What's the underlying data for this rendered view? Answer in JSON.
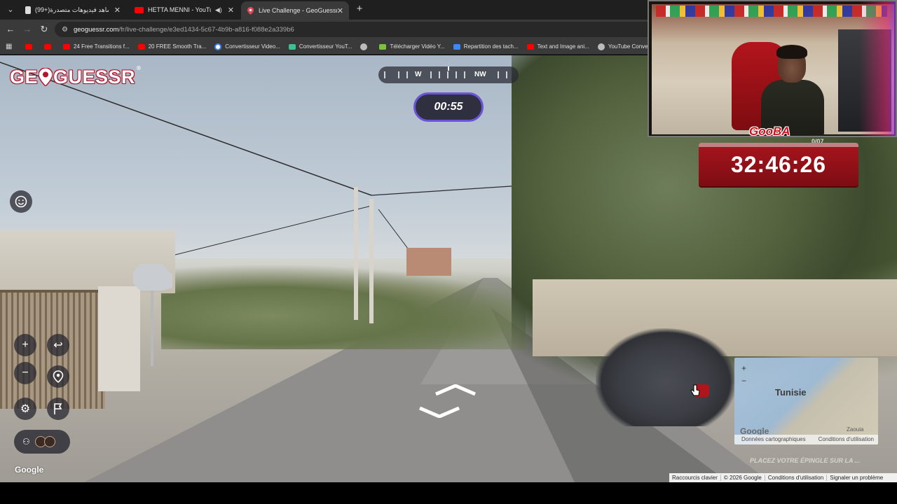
{
  "browser": {
    "tabs": [
      {
        "title": "(99+)شاهد فيديوهات متصدرة",
        "favicon_color": "#ffffff",
        "active": false
      },
      {
        "title": "HETTA MENNI - YouTube",
        "favicon_color": "#ff0000",
        "active": false,
        "audio": true
      },
      {
        "title": "Live Challenge - GeoGuessr",
        "favicon_color": "#e24a5a",
        "active": true
      }
    ],
    "tab_close_glyph": "✕",
    "new_tab_glyph": "+",
    "address": {
      "domain": "geoguessr.com",
      "path": "/fr/live-challenge/e3ed1434-5c67-4b9b-a816-f088e2a339b6"
    },
    "bookmarks": [
      {
        "label": "",
        "icon": "youtube-icon",
        "color": "#ff0000"
      },
      {
        "label": "",
        "icon": "youtube-icon",
        "color": "#ff0000"
      },
      {
        "label": "24 Free Transitions f...",
        "icon": "youtube-icon",
        "color": "#ff0000"
      },
      {
        "label": "20 FREE Smooth Tra...",
        "icon": "youtube-icon",
        "color": "#ff0000"
      },
      {
        "label": "Convertisseur Video...",
        "icon": "google-icon",
        "color": "#ffffff"
      },
      {
        "label": "Convertisseur YouT...",
        "icon": "convert-icon",
        "color": "#3fbf8f"
      },
      {
        "label": "",
        "icon": "globe-icon",
        "color": "#bbbbbb"
      },
      {
        "label": "Télécharger Vidéo Y...",
        "icon": "download-icon",
        "color": "#7cc242"
      },
      {
        "label": "Repartition des tach...",
        "icon": "docs-icon",
        "color": "#4285f4"
      },
      {
        "label": "Text and Image ani...",
        "icon": "youtube-icon",
        "color": "#ff0000"
      },
      {
        "label": "YouTube Converter...",
        "icon": "globe-icon",
        "color": "#bbbbbb"
      }
    ]
  },
  "game": {
    "logo_text": [
      "GE",
      "GUESSR"
    ],
    "logo_reg": "®",
    "compass": {
      "west": "W",
      "northwest": "NW"
    },
    "round_timer": "00:55",
    "map_label": "Tunisie",
    "map_place_small": "Zaouia",
    "map_footer_left": "Données cartographiques",
    "map_footer_right": "Conditions d'utilisation",
    "map_zoom_in": "+",
    "map_zoom_out": "−",
    "map_google": "Google",
    "pin_hint": "PLACEZ VOTRE ÉPINGLE SUR LA ...",
    "google_watermark": "Google",
    "footer": {
      "shortcuts": "Raccourcis clavier",
      "copyright": "© 2026 Google",
      "terms": "Conditions d'utilisation",
      "report": "Signaler un problème"
    },
    "controls": {
      "zoom_in": "+",
      "zoom_out": "−",
      "undo": "↩",
      "settings": "⚙"
    }
  },
  "stream": {
    "webcam_logo": "GooBA",
    "score_text": "0/07",
    "challenge_timer": "32:46:26"
  },
  "colors": {
    "brand_red": "#b0162b",
    "timer_border": "#6c54d8",
    "stream_timer_red": "#a8151d"
  }
}
